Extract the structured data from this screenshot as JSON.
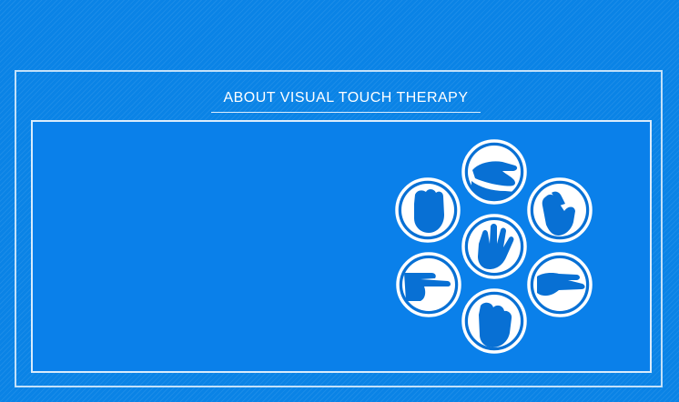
{
  "header": {
    "title": "ABOUT VISUAL TOUCH THERAPY"
  },
  "colors": {
    "background": "#0a83e6",
    "panel": "#0a80ea",
    "circle_fill": "#0870d4",
    "line": "#ffffff"
  },
  "icons": [
    "hand-palm-up-icon",
    "hand-fist-icon",
    "hand-reaching-icon",
    "hand-open-palm-icon",
    "hand-pointing-icon",
    "hand-flat-icon",
    "hand-cupped-icon"
  ]
}
